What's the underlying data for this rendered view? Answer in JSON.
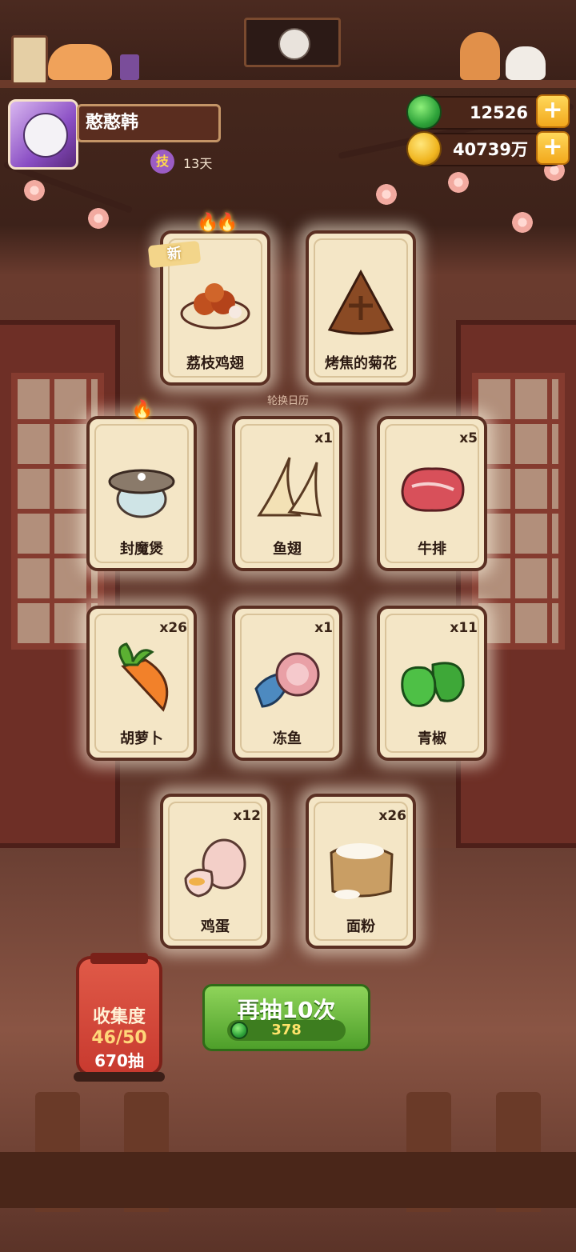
{
  "player": {
    "name": "憨憨韩",
    "skill_badge": "技",
    "skill_days": "13天"
  },
  "currency": {
    "jade": "12526",
    "coins": "40739万",
    "add_symbol": "+"
  },
  "rotation_calendar_label": "轮换日历",
  "new_tag": "新",
  "cards": [
    {
      "name": "荔枝鸡翅",
      "count": "",
      "is_new": true
    },
    {
      "name": "烤焦的菊花",
      "count": ""
    },
    {
      "name": "封魔煲",
      "count": ""
    },
    {
      "name": "鱼翅",
      "count": "x1"
    },
    {
      "name": "牛排",
      "count": "x5"
    },
    {
      "name": "胡萝卜",
      "count": "x26"
    },
    {
      "name": "冻鱼",
      "count": "x1"
    },
    {
      "name": "青椒",
      "count": "x11"
    },
    {
      "name": "鸡蛋",
      "count": "x12"
    },
    {
      "name": "面粉",
      "count": "x26"
    }
  ],
  "collection": {
    "title": "收集度",
    "progress": "46/50",
    "draws": "670抽"
  },
  "draw_button": {
    "label": "再抽10次",
    "cost": "378"
  }
}
